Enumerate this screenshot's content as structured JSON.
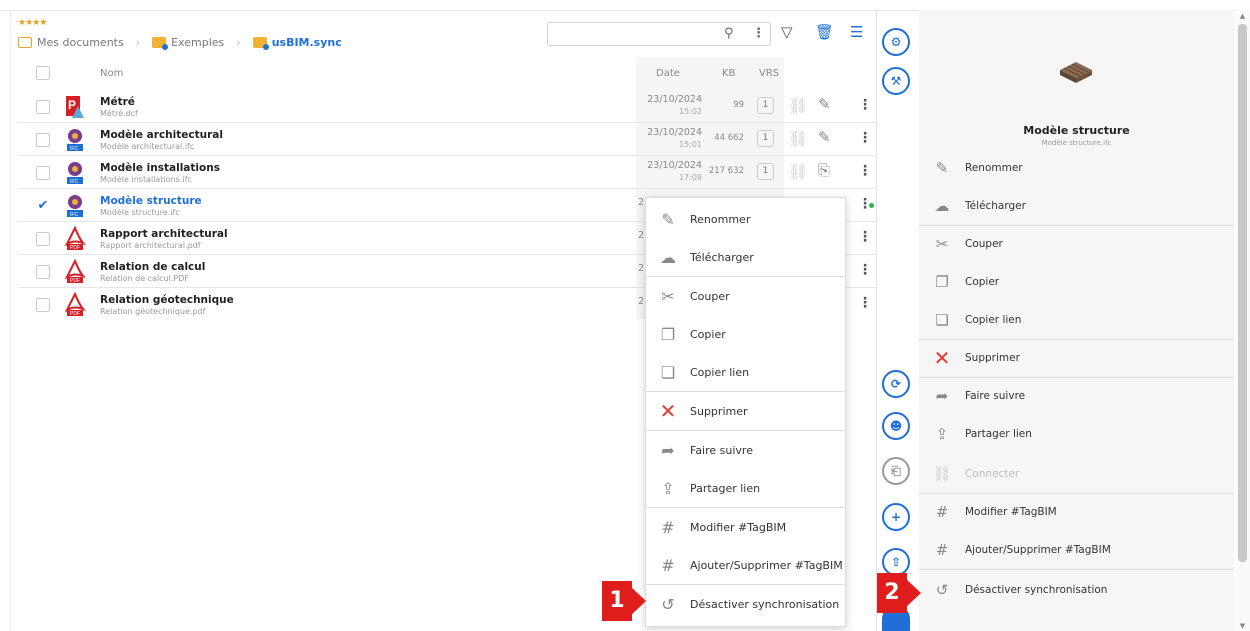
{
  "header": {
    "stars": "★★★★",
    "breadcrumb": [
      "Mes documents",
      "Exemples",
      "usBIM.sync"
    ]
  },
  "search": {
    "placeholder": ""
  },
  "columns": {
    "name": "Nom",
    "date": "Date",
    "kb": "KB",
    "vrs": "VRS"
  },
  "files": [
    {
      "name": "Métré",
      "sub": "Métré.dcf",
      "type": "dcf",
      "date": "23/10/2024",
      "time": "15:02",
      "kb": "99",
      "vrs": "1",
      "checked": false
    },
    {
      "name": "Modèle architectural",
      "sub": "Modèle architectural.ifc",
      "type": "ifc",
      "date": "23/10/2024",
      "time": "15:01",
      "kb": "44 662",
      "vrs": "1",
      "checked": false
    },
    {
      "name": "Modèle installations",
      "sub": "Modèle installations.ifc",
      "type": "ifc",
      "date": "23/10/2024",
      "time": "17:09",
      "kb": "217 632",
      "vrs": "1",
      "checked": false
    },
    {
      "name": "Modèle structure",
      "sub": "Modèle structure.ifc",
      "type": "ifc",
      "date": "2",
      "time": "",
      "kb": "",
      "vrs": "",
      "checked": true
    },
    {
      "name": "Rapport architectural",
      "sub": "Rapport architectural.pdf",
      "type": "pdf",
      "date": "2",
      "time": "",
      "kb": "",
      "vrs": "",
      "checked": false
    },
    {
      "name": "Relation de calcul",
      "sub": "Relation de calcul.PDF",
      "type": "pdf",
      "date": "2",
      "time": "",
      "kb": "",
      "vrs": "",
      "checked": false
    },
    {
      "name": "Relation géotechnique",
      "sub": "Relation géotechnique.pdf",
      "type": "pdf",
      "date": "2",
      "time": "",
      "kb": "",
      "vrs": "",
      "checked": false
    }
  ],
  "context_menu": {
    "items": [
      {
        "label": "Renommer",
        "icon": "pencil-icon"
      },
      {
        "label": "Télécharger",
        "icon": "cloud-download-icon"
      },
      {
        "label": "Couper",
        "icon": "scissors-icon"
      },
      {
        "label": "Copier",
        "icon": "copy-icon"
      },
      {
        "label": "Copier lien",
        "icon": "copy-link-icon"
      },
      {
        "label": "Supprimer",
        "icon": "delete-icon"
      },
      {
        "label": "Faire suivre",
        "icon": "forward-icon"
      },
      {
        "label": "Partager lien",
        "icon": "share-icon"
      },
      {
        "label": "Modifier #TagBIM",
        "icon": "hashtag-edit-icon"
      },
      {
        "label": "Ajouter/Supprimer #TagBIM",
        "icon": "hashtag-add-icon"
      },
      {
        "label": "Désactiver synchronisation",
        "icon": "sync-off-icon"
      }
    ]
  },
  "panel": {
    "title": "Modèle structure",
    "subtitle": "Modèle structure.ifc",
    "items": [
      {
        "label": "Renommer"
      },
      {
        "label": "Télécharger"
      },
      {
        "label": "Couper"
      },
      {
        "label": "Copier"
      },
      {
        "label": "Copier lien"
      },
      {
        "label": "Supprimer"
      },
      {
        "label": "Faire suivre"
      },
      {
        "label": "Partager lien"
      },
      {
        "label": "Connecter"
      },
      {
        "label": "Modifier #TagBIM"
      },
      {
        "label": "Ajouter/Supprimer #TagBIM"
      },
      {
        "label": "Désactiver synchronisation"
      }
    ]
  },
  "annotations": {
    "badge1": "1",
    "badge2": "2"
  },
  "colors": {
    "accent": "#1f6fd6",
    "danger": "#e53935",
    "badge": "#e01d1d",
    "sync_dot": "#2db34a"
  }
}
